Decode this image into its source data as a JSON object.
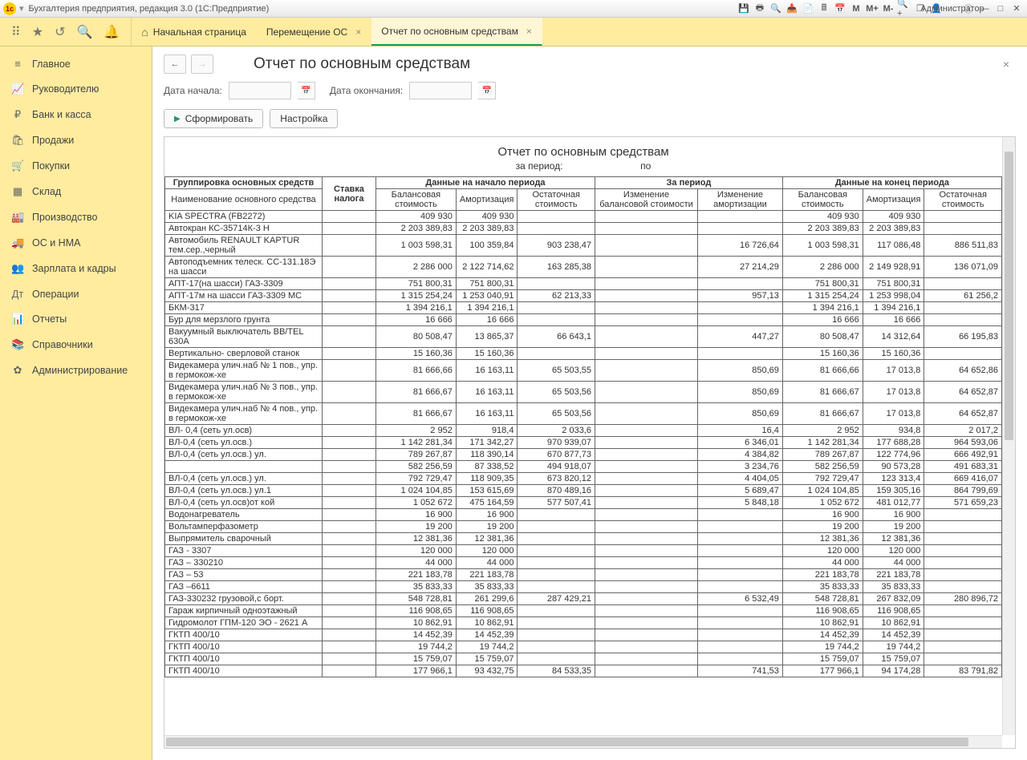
{
  "title": "Бухгалтерия предприятия, редакция 3.0  (1С:Предприятие)",
  "admin_label": "Администратор",
  "tabs": {
    "home": "Начальная страница",
    "t1": "Перемещение ОС",
    "t2": "Отчет по основным средствам"
  },
  "sidebar": [
    {
      "icon": "≡",
      "label": "Главное"
    },
    {
      "icon": "📈",
      "label": "Руководителю"
    },
    {
      "icon": "₽",
      "label": "Банк и касса"
    },
    {
      "icon": "🛍",
      "label": "Продажи"
    },
    {
      "icon": "🛒",
      "label": "Покупки"
    },
    {
      "icon": "▦",
      "label": "Склад"
    },
    {
      "icon": "🏭",
      "label": "Производство"
    },
    {
      "icon": "🚚",
      "label": "ОС и НМА"
    },
    {
      "icon": "👥",
      "label": "Зарплата и кадры"
    },
    {
      "icon": "Дт",
      "label": "Операции"
    },
    {
      "icon": "📊",
      "label": "Отчеты"
    },
    {
      "icon": "📚",
      "label": "Справочники"
    },
    {
      "icon": "✿",
      "label": "Администрирование"
    }
  ],
  "page_title": "Отчет по основным средствам",
  "filters": {
    "start_label": "Дата начала:",
    "end_label": "Дата окончания:",
    "start_value": "",
    "end_value": ""
  },
  "buttons": {
    "generate": "Сформировать",
    "settings": "Настройка"
  },
  "report_title": "Отчет по основным средствам",
  "report_sub_a": "за период:",
  "report_sub_b": "по",
  "headers": {
    "group": "Группировка основных средств",
    "name": "Наименование основного средства",
    "tax": "Ставка налога",
    "begin": "Данные на начало периода",
    "period": "За период",
    "end": "Данные на конец периода",
    "bal": "Балансовая стоимость",
    "amort": "Амортизация",
    "resid": "Остаточная стоимость",
    "dbal": "Изменение балансовой стоимости",
    "damort": "Изменение амортизации"
  },
  "rows": [
    {
      "n": "KIA SPECTRA (FB2272)",
      "b1": "409 930",
      "a1": "409 930",
      "r1": "",
      "db": "",
      "da": "",
      "b2": "409 930",
      "a2": "409 930",
      "r2": ""
    },
    {
      "n": "Автокран КС-35714К-3  H",
      "b1": "2 203 389,83",
      "a1": "2 203 389,83",
      "r1": "",
      "db": "",
      "da": "",
      "b2": "2 203 389,83",
      "a2": "2 203 389,83",
      "r2": ""
    },
    {
      "n": "Автомобиль RENAULT KAPTUR тем.сер.,черный",
      "b1": "1 003 598,31",
      "a1": "100 359,84",
      "r1": "903 238,47",
      "db": "",
      "da": "16 726,64",
      "b2": "1 003 598,31",
      "a2": "117 086,48",
      "r2": "886 511,83"
    },
    {
      "n": "Автоподъемник телеск. СС-131.18Э на шасси",
      "b1": "2 286 000",
      "a1": "2 122 714,62",
      "r1": "163 285,38",
      "db": "",
      "da": "27 214,29",
      "b2": "2 286 000",
      "a2": "2 149 928,91",
      "r2": "136 071,09"
    },
    {
      "n": "АПТ-17(на шасси) ГАЗ-3309",
      "b1": "751 800,31",
      "a1": "751 800,31",
      "r1": "",
      "db": "",
      "da": "",
      "b2": "751 800,31",
      "a2": "751 800,31",
      "r2": ""
    },
    {
      "n": "АПТ-17м на шасси ГАЗ-3309 МС",
      "b1": "1 315 254,24",
      "a1": "1 253 040,91",
      "r1": "62 213,33",
      "db": "",
      "da": "957,13",
      "b2": "1 315 254,24",
      "a2": "1 253 998,04",
      "r2": "61 256,2"
    },
    {
      "n": "БКМ-317",
      "b1": "1 394 216,1",
      "a1": "1 394 216,1",
      "r1": "",
      "db": "",
      "da": "",
      "b2": "1 394 216,1",
      "a2": "1 394 216,1",
      "r2": ""
    },
    {
      "n": "Бур для мерзлого грунта",
      "b1": "16 666",
      "a1": "16 666",
      "r1": "",
      "db": "",
      "da": "",
      "b2": "16 666",
      "a2": "16 666",
      "r2": ""
    },
    {
      "n": "Вакуумный выключатель BB/TEL 630А",
      "b1": "80 508,47",
      "a1": "13 865,37",
      "r1": "66 643,1",
      "db": "",
      "da": "447,27",
      "b2": "80 508,47",
      "a2": "14 312,64",
      "r2": "66 195,83"
    },
    {
      "n": "Вертикально- сверловой станок",
      "b1": "15 160,36",
      "a1": "15 160,36",
      "r1": "",
      "db": "",
      "da": "",
      "b2": "15 160,36",
      "a2": "15 160,36",
      "r2": ""
    },
    {
      "n": "Видекамера улич.наб № 1 пов., упр. в гермокож-хе",
      "b1": "81 666,66",
      "a1": "16 163,11",
      "r1": "65 503,55",
      "db": "",
      "da": "850,69",
      "b2": "81 666,66",
      "a2": "17 013,8",
      "r2": "64 652,86"
    },
    {
      "n": "Видекамера улич.наб № 3 пов., упр. в гермокож-хе",
      "b1": "81 666,67",
      "a1": "16 163,11",
      "r1": "65 503,56",
      "db": "",
      "da": "850,69",
      "b2": "81 666,67",
      "a2": "17 013,8",
      "r2": "64 652,87"
    },
    {
      "n": "Видекамера улич.наб № 4 пов., упр. в гермокож-хе",
      "b1": "81 666,67",
      "a1": "16 163,11",
      "r1": "65 503,56",
      "db": "",
      "da": "850,69",
      "b2": "81 666,67",
      "a2": "17 013,8",
      "r2": "64 652,87"
    },
    {
      "n": "ВЛ- 0,4 (сеть ул.осв)",
      "b1": "2 952",
      "a1": "918,4",
      "r1": "2 033,6",
      "db": "",
      "da": "16,4",
      "b2": "2 952",
      "a2": "934,8",
      "r2": "2 017,2"
    },
    {
      "n": "ВЛ-0,4 (сеть ул.осв.)",
      "b1": "1 142 281,34",
      "a1": "171 342,27",
      "r1": "970 939,07",
      "db": "",
      "da": "6 346,01",
      "b2": "1 142 281,34",
      "a2": "177 688,28",
      "r2": "964 593,06"
    },
    {
      "n": "ВЛ-0,4 (сеть ул.осв.) ул.",
      "b1": "789 267,87",
      "a1": "118 390,14",
      "r1": "670 877,73",
      "db": "",
      "da": "4 384,82",
      "b2": "789 267,87",
      "a2": "122 774,96",
      "r2": "666 492,91"
    },
    {
      "n": "",
      "b1": "582 256,59",
      "a1": "87 338,52",
      "r1": "494 918,07",
      "db": "",
      "da": "3 234,76",
      "b2": "582 256,59",
      "a2": "90 573,28",
      "r2": "491 683,31"
    },
    {
      "n": "ВЛ-0,4 (сеть ул.осв.) ул.",
      "b1": "792 729,47",
      "a1": "118 909,35",
      "r1": "673 820,12",
      "db": "",
      "da": "4 404,05",
      "b2": "792 729,47",
      "a2": "123 313,4",
      "r2": "669 416,07"
    },
    {
      "n": "ВЛ-0,4 (сеть ул.осв.) ул.1",
      "b1": "1 024 104,85",
      "a1": "153 615,69",
      "r1": "870 489,16",
      "db": "",
      "da": "5 689,47",
      "b2": "1 024 104,85",
      "a2": "159 305,16",
      "r2": "864 799,69"
    },
    {
      "n": "ВЛ-0,4 (сеть ул.осв)от    кой",
      "b1": "1 052 672",
      "a1": "475 164,59",
      "r1": "577 507,41",
      "db": "",
      "da": "5 848,18",
      "b2": "1 052 672",
      "a2": "481 012,77",
      "r2": "571 659,23"
    },
    {
      "n": "Водонагреватель",
      "b1": "16 900",
      "a1": "16 900",
      "r1": "",
      "db": "",
      "da": "",
      "b2": "16 900",
      "a2": "16 900",
      "r2": ""
    },
    {
      "n": "Вольтамперфазометр",
      "b1": "19 200",
      "a1": "19 200",
      "r1": "",
      "db": "",
      "da": "",
      "b2": "19 200",
      "a2": "19 200",
      "r2": ""
    },
    {
      "n": "Выпрямитель сварочный",
      "b1": "12 381,36",
      "a1": "12 381,36",
      "r1": "",
      "db": "",
      "da": "",
      "b2": "12 381,36",
      "a2": "12 381,36",
      "r2": ""
    },
    {
      "n": "ГАЗ - 3307",
      "b1": "120 000",
      "a1": "120 000",
      "r1": "",
      "db": "",
      "da": "",
      "b2": "120 000",
      "a2": "120 000",
      "r2": ""
    },
    {
      "n": "ГАЗ – 330210",
      "b1": "44 000",
      "a1": "44 000",
      "r1": "",
      "db": "",
      "da": "",
      "b2": "44 000",
      "a2": "44 000",
      "r2": ""
    },
    {
      "n": "ГАЗ – 53",
      "b1": "221 183,78",
      "a1": "221 183,78",
      "r1": "",
      "db": "",
      "da": "",
      "b2": "221 183,78",
      "a2": "221 183,78",
      "r2": ""
    },
    {
      "n": "ГАЗ –6611",
      "b1": "35 833,33",
      "a1": "35 833,33",
      "r1": "",
      "db": "",
      "da": "",
      "b2": "35 833,33",
      "a2": "35 833,33",
      "r2": ""
    },
    {
      "n": "ГАЗ-330232  грузовой,с борт.",
      "b1": "548 728,81",
      "a1": "261 299,6",
      "r1": "287 429,21",
      "db": "",
      "da": "6 532,49",
      "b2": "548 728,81",
      "a2": "267 832,09",
      "r2": "280 896,72"
    },
    {
      "n": "Гараж кирпичный одноэтажный",
      "b1": "116 908,65",
      "a1": "116 908,65",
      "r1": "",
      "db": "",
      "da": "",
      "b2": "116 908,65",
      "a2": "116 908,65",
      "r2": ""
    },
    {
      "n": "Гидромолот ГПМ-120      ЭО - 2621 А",
      "b1": "10 862,91",
      "a1": "10 862,91",
      "r1": "",
      "db": "",
      "da": "",
      "b2": "10 862,91",
      "a2": "10 862,91",
      "r2": ""
    },
    {
      "n": "ГКТП 400/10",
      "b1": "14 452,39",
      "a1": "14 452,39",
      "r1": "",
      "db": "",
      "da": "",
      "b2": "14 452,39",
      "a2": "14 452,39",
      "r2": ""
    },
    {
      "n": "ГКТП 400/10",
      "b1": "19 744,2",
      "a1": "19 744,2",
      "r1": "",
      "db": "",
      "da": "",
      "b2": "19 744,2",
      "a2": "19 744,2",
      "r2": ""
    },
    {
      "n": "ГКТП 400/10",
      "b1": "15 759,07",
      "a1": "15 759,07",
      "r1": "",
      "db": "",
      "da": "",
      "b2": "15 759,07",
      "a2": "15 759,07",
      "r2": ""
    },
    {
      "n": "ГКТП 400/10",
      "b1": "177 966,1",
      "a1": "93 432,75",
      "r1": "84 533,35",
      "db": "",
      "da": "741,53",
      "b2": "177 966,1",
      "a2": "94 174,28",
      "r2": "83 791,82"
    }
  ]
}
